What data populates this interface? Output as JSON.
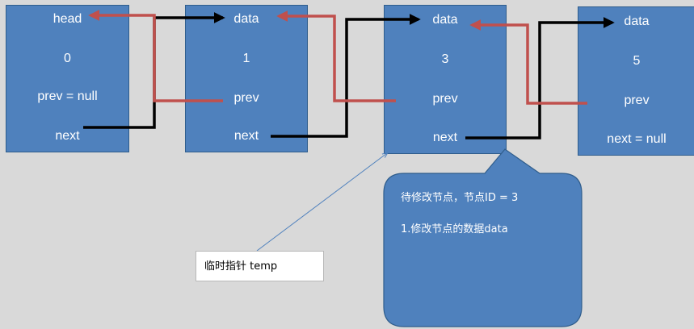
{
  "colors": {
    "node_fill": "#4f81bd",
    "next_arrow": "#000000",
    "prev_arrow": "#c0504d",
    "pointer_line": "#4f81bd"
  },
  "nodes": [
    {
      "top_label": "head",
      "value": "0",
      "prev": "prev = null",
      "next": "next"
    },
    {
      "top_label": "data",
      "value": "1",
      "prev": "prev",
      "next": "next"
    },
    {
      "top_label": "data",
      "value": "3",
      "prev": "prev",
      "next": "next"
    },
    {
      "top_label": "data",
      "value": "5",
      "prev": "prev",
      "next": "next = null"
    }
  ],
  "callout": {
    "line1": "待修改节点，节点ID = 3",
    "line2": "1.修改节点的数据data"
  },
  "temp_pointer": {
    "label": "临时指针 temp"
  }
}
